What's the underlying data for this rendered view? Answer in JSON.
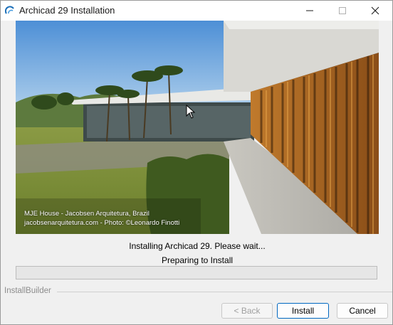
{
  "window": {
    "title": "Archicad 29 Installation",
    "app_icon": "archicad-logo-icon",
    "controls": [
      "minimize-icon",
      "maximize-icon",
      "close-icon"
    ]
  },
  "hero": {
    "caption_line1": "MJE House - Jacobsen Arquitetura, Brazil",
    "caption_line2": "jacobsenarquitetura.com - Photo: ©Leonardo Finotti"
  },
  "status": {
    "line1": "Installing Archicad 29. Please wait...",
    "line2": "Preparing to Install"
  },
  "progress": {
    "value_percent": 0,
    "fill_color": "#06b025"
  },
  "footer": {
    "group_label": "InstallBuilder"
  },
  "buttons": {
    "back": "< Back",
    "install": "Install",
    "cancel": "Cancel"
  },
  "colors": {
    "accent": "#0067c0"
  }
}
